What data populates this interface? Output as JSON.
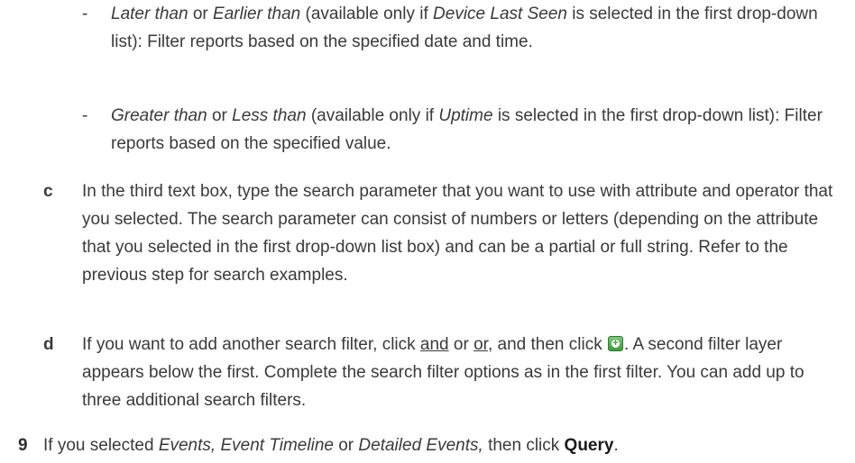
{
  "sub_items": [
    {
      "dash": "-",
      "term1": "Later than",
      "or_word": "or",
      "term2": "Earlier than",
      "avail_prefix": "(available only if",
      "field": "Device Last Seen",
      "avail_suffix": "is selected in the first drop-down list): Filter reports based on the specified date and time."
    },
    {
      "dash": "-",
      "term1": "Greater than",
      "or_word": "or",
      "term2": "Less than",
      "avail_prefix": "(available only if",
      "field": "Uptime",
      "avail_suffix": "is selected in the first drop-down list): Filter reports based on the specified value."
    }
  ],
  "step_c": {
    "label": "c",
    "text": "In the third text box, type the search parameter that you want to use with attribute and operator that you selected. The search parameter can consist of numbers or letters (depending on the attribute that you selected in the first drop-down list box) and can be a partial or full string. Refer to the previous step for search examples."
  },
  "step_d": {
    "label": "d",
    "text_before": "If you want to add another search filter, click",
    "and_link": "and",
    "or_sep": "or",
    "or_link": "or",
    "text_mid": ", and then click",
    "icon": "add-filter-icon",
    "text_after": ". A second filter layer appears below the first. Complete the search filter options as in the first filter. You can add up to three additional search filters."
  },
  "step_9": {
    "label": "9",
    "text_before": "If you selected",
    "options": "Events, Event Timeline",
    "or_word": "or",
    "option_last": "Detailed Events,",
    "text_mid": "then click",
    "button": "Query",
    "text_end": "."
  }
}
